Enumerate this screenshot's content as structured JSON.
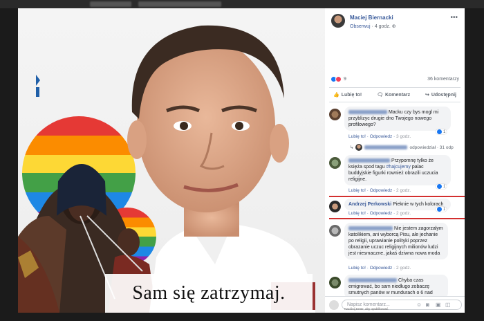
{
  "post": {
    "author": "Maciej Biernacki",
    "follow": "Obserwuj",
    "time": "4 godz.",
    "more": "•••"
  },
  "stats": {
    "reactions_count": "9",
    "comments_count": "36 komentarzy"
  },
  "actions": {
    "like": "Lubię to!",
    "comment": "Komentarz",
    "share": "Udostępnij"
  },
  "photo": {
    "caption": "Sam się zatrzymaj."
  },
  "comments": [
    {
      "text": "Macku czy bys mogl mi przyblizyc drugie dno Twojego nowego profilowego?",
      "like": "Lubię to!",
      "reply": "Odpowiedz",
      "time": "3 godz.",
      "reactions": "1",
      "reply_preview": "odpowiedział · 31 odp"
    },
    {
      "text": "Przypomnę tylko że księża spod tagu ",
      "tag": "#hajcujemy",
      "text2": " palac buddyjskie figurki rownież obrazili uczucia religijne.",
      "like": "Lubię to!",
      "reply": "Odpowiedz",
      "time": "2 godz.",
      "reactions": "1"
    },
    {
      "author": "Andrzej Perkowski",
      "text": " Pieknie w tych kolorach",
      "like": "Lubię to!",
      "reply": "Odpowiedz",
      "time": "2 godz.",
      "reactions": "1"
    },
    {
      "text": "Nie jestem zagorzałym katolikiem, ani wyborcą Pisu, ale jechanie po religii, uprawianie polityki poprzez obrazanie uczuc religijnych milionów ludzi jest niesmaczne, jakaś dziwna nowa moda",
      "like": "Lubię to!",
      "reply": "Odpowiedz",
      "time": "2 godz."
    },
    {
      "text": "Chyba czas emigrować, bo sam niedługo zobaczę smutnych panów w mundurach o 6 nad"
    }
  ],
  "composer": {
    "placeholder": "Napisz komentarz...",
    "hint": "Naciśnij Enter, aby opublikować."
  },
  "colors": {
    "link": "#385898",
    "like_blue": "#1877f2",
    "love_red": "#f33e58",
    "highlight_red": "#d32f2f"
  }
}
